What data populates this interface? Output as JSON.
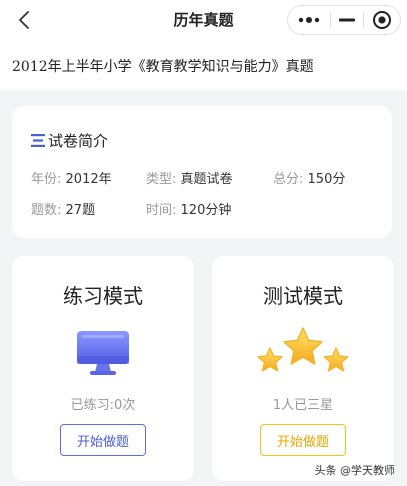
{
  "header": {
    "title": "历年真题",
    "back_icon": "chevron-left-icon",
    "capsule": {
      "more_icon": "more-dots-icon",
      "minimize_icon": "minus-icon",
      "close_icon": "target-circle-icon"
    }
  },
  "subject": {
    "title": "2012年上半年小学《教育教学知识与能力》真题"
  },
  "intro": {
    "heading": "试卷简介",
    "icon": "list-lines-icon",
    "fields": {
      "year": {
        "label": "年份:",
        "value": "2012年"
      },
      "type": {
        "label": "类型:",
        "value": "真题试卷"
      },
      "score": {
        "label": "总分:",
        "value": "150分"
      },
      "count": {
        "label": "题数:",
        "value": "27题"
      },
      "time": {
        "label": "时间:",
        "value": "120分钟"
      }
    }
  },
  "modes": {
    "practice": {
      "title": "练习模式",
      "icon": "monitor-icon",
      "status": "已练习:0次",
      "button": "开始做题"
    },
    "test": {
      "title": "测试模式",
      "icon": "three-stars-icon",
      "status": "1人已三星",
      "button": "开始做题"
    }
  },
  "watermark": {
    "text": "头条 @学天教师"
  },
  "colors": {
    "accent_blue": "#4a5fd8",
    "accent_yellow": "#f1c21b",
    "background": "#f3f4f6"
  }
}
